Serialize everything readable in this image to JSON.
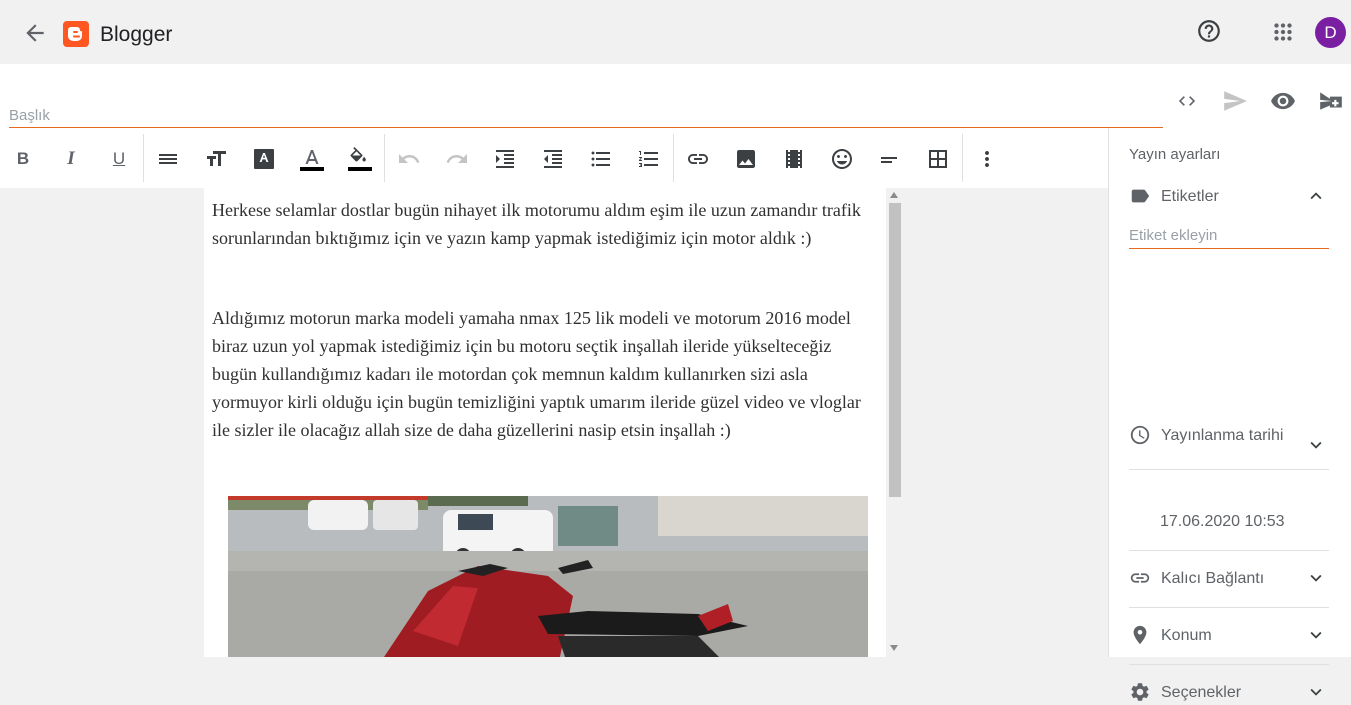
{
  "app": {
    "name": "Blogger",
    "avatar_initial": "D",
    "avatar_color": "#7b1fa2",
    "brand_color": "#ff5722"
  },
  "post": {
    "title_placeholder": "Başlık",
    "paragraphs": [
      "Herkese selamlar dostlar bugün nihayet ilk motorumu aldım eşim ile uzun zamandır trafik sorunlarından bıktığımız için ve yazın kamp yapmak istediğimiz için motor aldık :)",
      "Aldığımız motorun marka modeli yamaha nmax 125 lik modeli ve motorum 2016 model biraz uzun yol yapmak istediğimiz için bu motoru seçtik inşallah ileride yükselteceğiz bugün kullandığımız kadarı ile motordan çok memnun kaldım kullanırken sizi asla yormuyor kirli olduğu için bugün temizliğini yaptık umarım ileride güzel video ve vloglar ile sizler ile olacağız allah size de daha güzellerini nasip etsin inşallah :)"
    ]
  },
  "toolbar": {
    "bold": "B",
    "italic": "I",
    "underline": "U"
  },
  "sidebar": {
    "heading": "Yayın ayarları",
    "labels": {
      "title": "Etiketler",
      "placeholder": "Etiket ekleyin"
    },
    "publish_date": {
      "title": "Yayınlanma tarihi",
      "value": "17.06.2020 10:53"
    },
    "permalink": {
      "title": "Kalıcı Bağlantı"
    },
    "location": {
      "title": "Konum"
    },
    "options": {
      "title": "Seçenekler"
    }
  }
}
